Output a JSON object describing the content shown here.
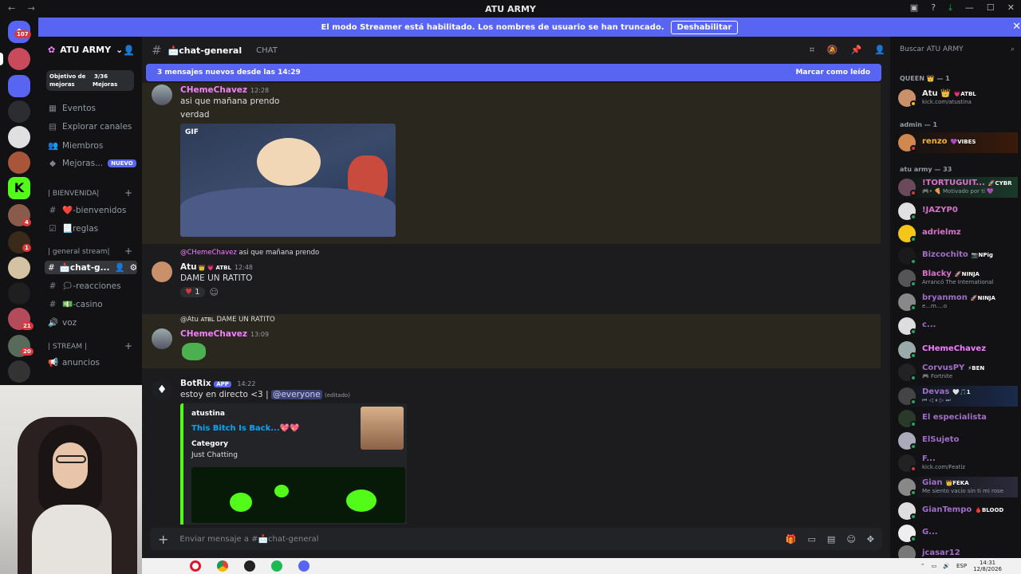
{
  "window": {
    "title": "ATU ARMY",
    "nav": "← →"
  },
  "streamer_bar": {
    "text": "El modo Streamer está habilitado. Los nombres de usuario se han truncado.",
    "button": "Deshabilitar"
  },
  "servers": {
    "dm_badge": "107",
    "badges": [
      "4",
      "1",
      "21",
      "20"
    ]
  },
  "sidebar": {
    "server_name": "ATU ARMY",
    "boost": {
      "label1": "Objetivo de",
      "label2": "mejoras",
      "count": "3/36",
      "count_label": "Mejoras"
    },
    "items": [
      {
        "label": "Eventos"
      },
      {
        "label": "Explorar canales"
      },
      {
        "label": "Miembros"
      },
      {
        "label": "Mejoras...",
        "badge": "NUEVO"
      }
    ],
    "categories": {
      "bienvenida": "| BIENVENIDA|",
      "general": "| general stream|",
      "stream": "| STREAM |"
    },
    "channels": [
      {
        "label": "❤️-bienvenidos"
      },
      {
        "label": "📃reglas"
      },
      {
        "label": "📩chat-g..."
      },
      {
        "label": "🗯-reacciones"
      },
      {
        "label": "💵-casino"
      },
      {
        "label": "voz"
      },
      {
        "label": "anuncios"
      }
    ]
  },
  "header": {
    "channel": "📩chat-general",
    "topic": "CHAT"
  },
  "new_messages": {
    "text": "3 mensajes nuevos desde las 14:29",
    "mark": "Marcar como leído"
  },
  "messages": [
    {
      "user": "CHemeChavez",
      "time": "12:28",
      "lines": [
        "asi que mañana prendo",
        "verdad"
      ],
      "gif_label": "GIF"
    },
    {
      "reply_user": "@CHemeChavez",
      "reply_text": "asi que mañana prendo",
      "user": "Atu",
      "role": "ATBL",
      "time": "12:48",
      "text": "DAME UN RATITO",
      "reaction_count": "1"
    },
    {
      "reply_user": "@Atu",
      "reply_role": "ATBL",
      "reply_text": "DAME UN RATITO",
      "user": "CHemeChavez",
      "time": "13:09"
    },
    {
      "user": "BotRix",
      "app": "APP",
      "time": "14:22",
      "text": "estoy en directo <3 |",
      "mention": "@everyone",
      "edited": "(editado)",
      "embed": {
        "author": "atustina",
        "title": "This Bitch Is Back...💖💖",
        "field_name": "Category",
        "field_value": "Just Chatting"
      }
    }
  ],
  "composer": {
    "placeholder": "Enviar mensaje a #📩chat-general"
  },
  "members": {
    "search": "Buscar ATU ARMY",
    "groups": [
      {
        "title": "QUEEN 👑 — 1"
      },
      {
        "title": "admin — 1"
      },
      {
        "title": "atu army — 33"
      }
    ],
    "list": [
      {
        "name": "Atu 👑",
        "tag": "💗ATBL",
        "status": "kick.com/atustina",
        "color": "#e8e8e8"
      },
      {
        "name": "renzo",
        "tag": "💜VIBES",
        "status": "",
        "color": "#f0b232"
      },
      {
        "name": "!TORTUGUIT...",
        "tag": "🚀CYBR",
        "status": "🎮• 🍕 Motivado por ti 💜",
        "color": "#d873c8"
      },
      {
        "name": "!JAZYP0",
        "tag": "",
        "status": "",
        "color": "#d873c8"
      },
      {
        "name": "adrielmz",
        "tag": "",
        "status": "",
        "color": "#d873c8"
      },
      {
        "name": "Bizcochito",
        "tag": "📷NPig",
        "status": "",
        "color": "#a06ec8"
      },
      {
        "name": "Blacky",
        "tag": "🚀NINJA",
        "status": "Arrancó The International",
        "color": "#d873c8"
      },
      {
        "name": "bryanmon",
        "tag": "🚀NINJA",
        "status": "e...m....o",
        "color": "#a06ec8"
      },
      {
        "name": "c...",
        "tag": "",
        "status": "",
        "color": "#a06ec8"
      },
      {
        "name": "CHemeChavez",
        "tag": "",
        "status": "",
        "color": "#f47fff"
      },
      {
        "name": "CorvusPY",
        "tag": "⚡BEN",
        "status": "🎮 Fortnite",
        "color": "#a06ec8"
      },
      {
        "name": "Devas",
        "tag": "🤍🎵1",
        "status": "⏮ ◁ ⏸ ▷ ⏭",
        "color": "#a06ec8"
      },
      {
        "name": "El especialista",
        "tag": "",
        "status": "",
        "color": "#a06ec8"
      },
      {
        "name": "ElSujeto",
        "tag": "",
        "status": "",
        "color": "#a06ec8"
      },
      {
        "name": "F...",
        "tag": "",
        "status": "kick.com/Featiz",
        "color": "#a06ec8"
      },
      {
        "name": "Gian",
        "tag": "👑FEKA",
        "status": "Me siento vacio sin ti mi rose",
        "color": "#a06ec8"
      },
      {
        "name": "GianTempo",
        "tag": "🩸BLOOD",
        "status": "",
        "color": "#a06ec8"
      },
      {
        "name": "G...",
        "tag": "",
        "status": "",
        "color": "#a06ec8"
      },
      {
        "name": "jcasar12",
        "tag": "",
        "status": "",
        "color": "#a06ec8"
      }
    ]
  },
  "taskbar": {
    "lang": "ESP",
    "time": "14:31",
    "date": "12/8/2026"
  }
}
